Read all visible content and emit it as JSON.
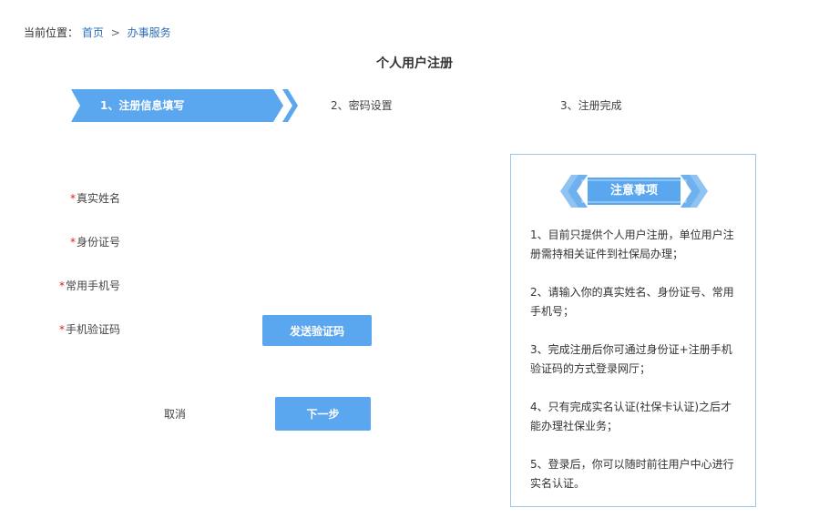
{
  "breadcrumb": {
    "label": "当前位置：",
    "home": "首页",
    "separator": ">",
    "current": "办事服务"
  },
  "page_title": "个人用户注册",
  "steps": [
    {
      "label": "1、注册信息填写",
      "active": true
    },
    {
      "label": "2、密码设置",
      "active": false
    },
    {
      "label": "3、注册完成",
      "active": false
    }
  ],
  "form": {
    "required_mark": "*",
    "name_label": "真实姓名",
    "id_label": "身份证号",
    "phone_label": "常用手机号",
    "code_label": "手机验证码",
    "send_code_button": "发送验证码",
    "cancel_button": "取消",
    "next_button": "下一步"
  },
  "notice": {
    "title": "注意事项",
    "items": [
      "1、目前只提供个人用户注册，单位用户注册需持相关证件到社保局办理；",
      "2、请输入你的真实姓名、身份证号、常用手机号；",
      "3、完成注册后你可通过身份证+注册手机验证码的方式登录网厅；",
      "4、只有完成实名认证(社保卡认证)之后才能办理社保业务；",
      "5、登录后，你可以随时前往用户中心进行实名认证。"
    ]
  },
  "colors": {
    "accent": "#5aa7ef",
    "link": "#2f6fb8",
    "required": "#e02020",
    "panel_border": "#9ec5ea"
  }
}
